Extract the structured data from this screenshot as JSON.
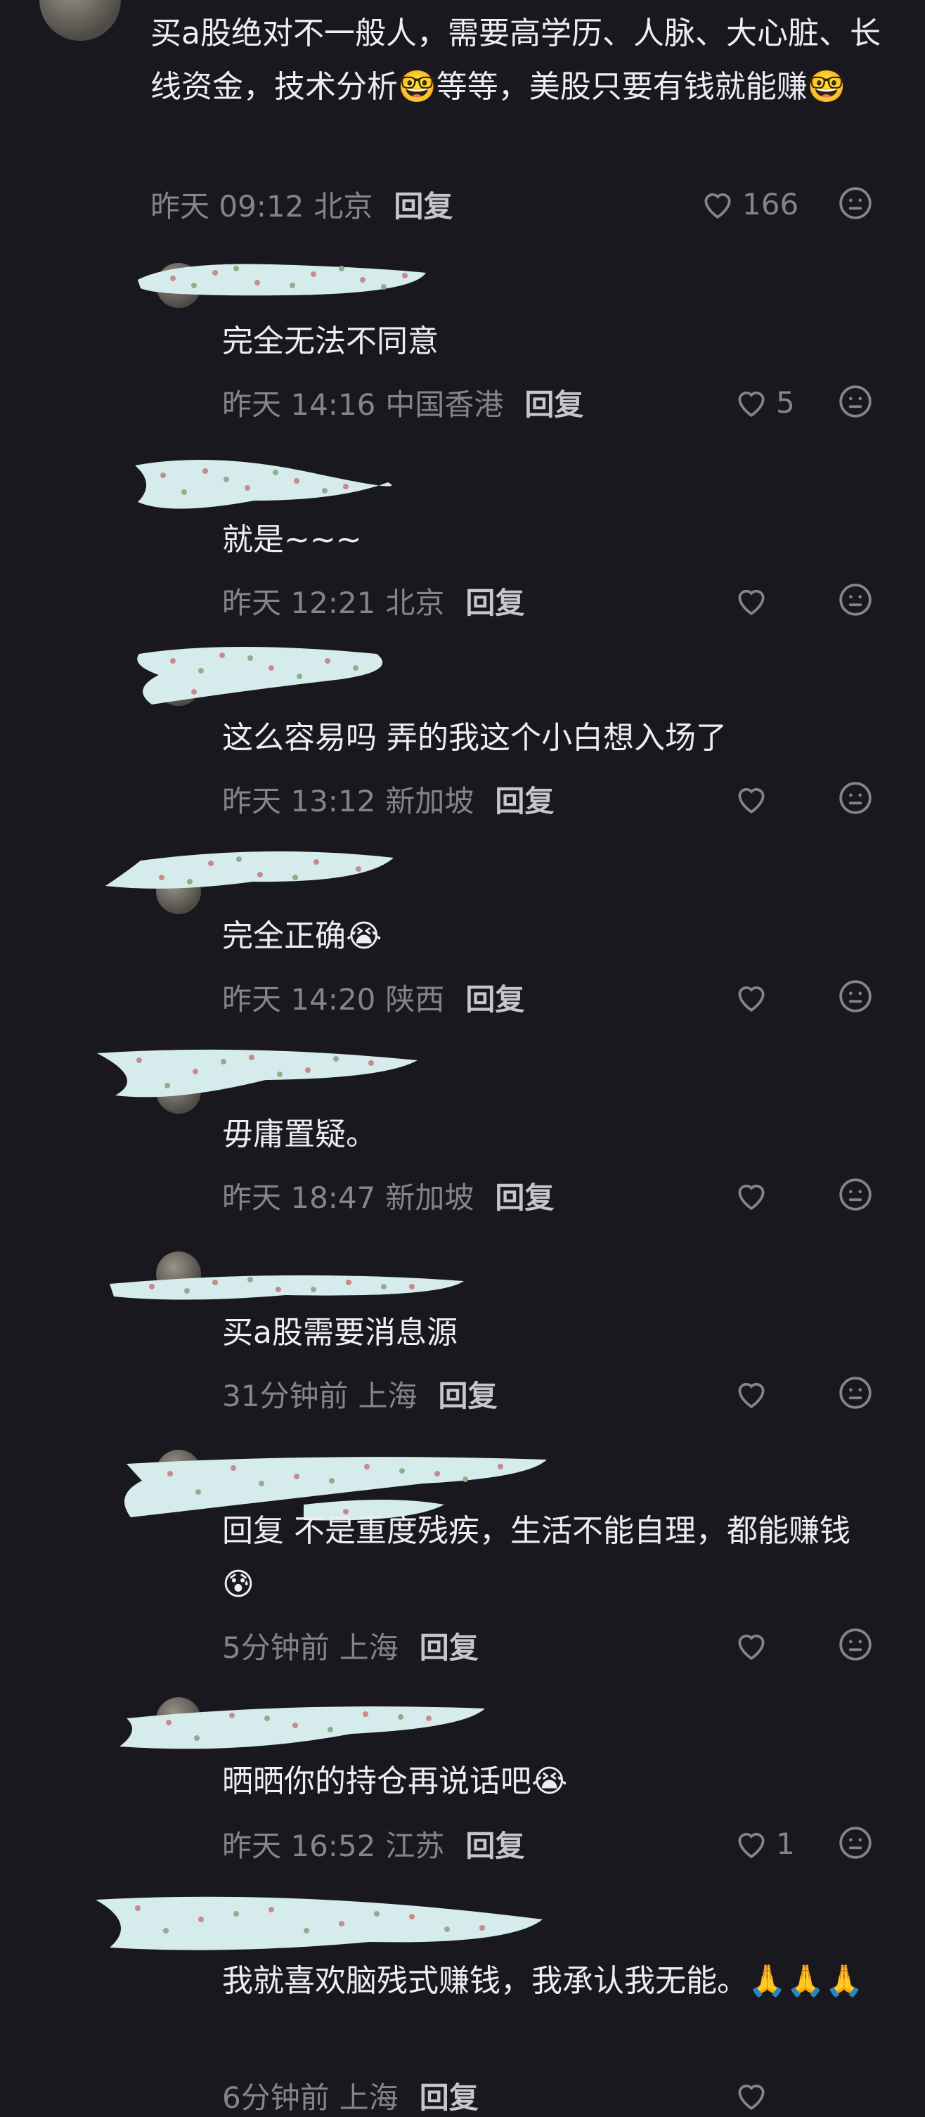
{
  "comments": [
    {
      "text": "买a股绝对不一般人，需要高学历、人脉、大心脏、长线资金，技术分析🤓等等，美股只要有钱就能赚🤓",
      "time": "昨天 09:12",
      "location": "北京",
      "reply": "回复",
      "likes": "166"
    },
    {
      "text": "完全无法不同意",
      "time": "昨天 14:16",
      "location": "中国香港",
      "reply": "回复",
      "likes": "5"
    },
    {
      "text": "就是~~~",
      "time": "昨天 12:21",
      "location": "北京",
      "reply": "回复",
      "likes": ""
    },
    {
      "text": "这么容易吗 弄的我这个小白想入场了",
      "time": "昨天 13:12",
      "location": "新加坡",
      "reply": "回复",
      "likes": ""
    },
    {
      "text": "完全正确😭",
      "time": "昨天 14:20",
      "location": "陕西",
      "reply": "回复",
      "likes": ""
    },
    {
      "text": "毋庸置疑。",
      "time": "昨天 18:47",
      "location": "新加坡",
      "reply": "回复",
      "likes": ""
    },
    {
      "text": "买a股需要消息源",
      "time": "31分钟前",
      "location": "上海",
      "reply": "回复",
      "likes": ""
    },
    {
      "text": "回复 不是重度残疾，生活不能自理，都能赚钱😰",
      "time": "5分钟前",
      "location": "上海",
      "reply": "回复",
      "likes": ""
    },
    {
      "text": "晒晒你的持仓再说话吧😭",
      "time": "昨天 16:52",
      "location": "江苏",
      "reply": "回复",
      "likes": "1"
    },
    {
      "text": "我就喜欢脑残式赚钱，我承认我无能。🙏🙏🙏",
      "time": "6分钟前",
      "location": "上海",
      "reply": "回复",
      "likes": ""
    }
  ],
  "icons": {
    "like": "heart-outline-icon",
    "react": "neutral-face-icon"
  },
  "colors": {
    "background": "#19181e",
    "text": "#eeedf2",
    "meta": "#85848c",
    "reply": "#c7c6cc",
    "mask": "#d6ecec"
  }
}
